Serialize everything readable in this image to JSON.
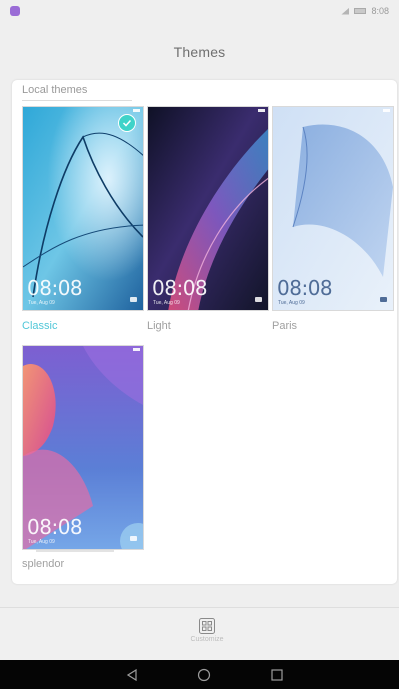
{
  "status_bar": {
    "time": "8:08",
    "app_icon": "theme-app-icon",
    "icons": [
      "wifi-icon",
      "signal-icon",
      "battery-icon"
    ]
  },
  "header": {
    "title": "Themes"
  },
  "section": {
    "title": "Local themes"
  },
  "themes": [
    {
      "name": "Classic",
      "time": "08:08",
      "date": "Tue, Aug 09",
      "selected": true
    },
    {
      "name": "Light",
      "time": "08:08",
      "date": "Tue, Aug 09",
      "selected": false
    },
    {
      "name": "Paris",
      "time": "08:08",
      "date": "Tue, Aug 09",
      "selected": false
    },
    {
      "name": "splendor",
      "time": "08:08",
      "date": "Tue, Aug 09",
      "selected": false
    }
  ],
  "bottom_tab": {
    "label": "Customize",
    "icon": "customize-grid-icon"
  },
  "nav": {
    "back": "back-icon",
    "home": "home-icon",
    "recents": "recents-icon"
  },
  "colors": {
    "accent": "#50c7d8",
    "check": "#3fd3c9",
    "background": "#efefef"
  }
}
